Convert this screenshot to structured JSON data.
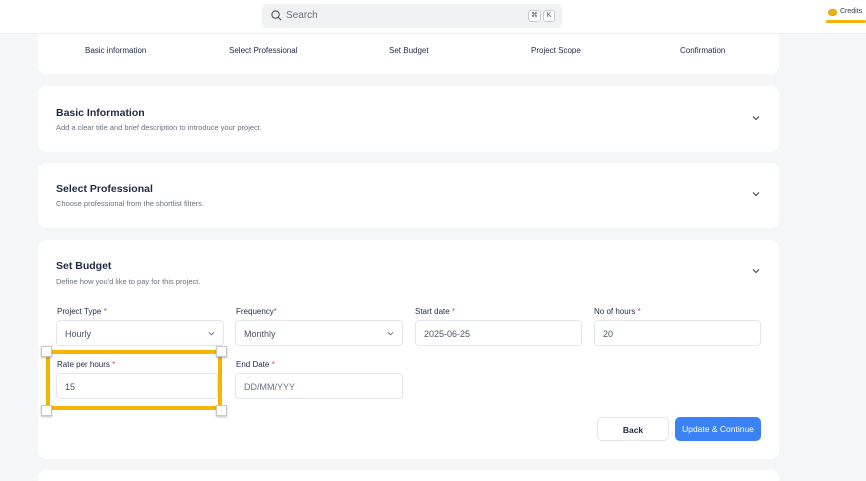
{
  "search": {
    "placeholder": "Search",
    "shortcut_cmd": "⌘",
    "shortcut_key": "K"
  },
  "credits": {
    "label": "Credits",
    "coin_color": "#f2b30b"
  },
  "stepper": {
    "steps": [
      "Basic information",
      "Select Professional",
      "Set Budget",
      "Project Scope",
      "Confirmation"
    ]
  },
  "sections": {
    "basic": {
      "title": "Basic Information",
      "description": "Add a clear title and brief description to introduce your project."
    },
    "professional": {
      "title": "Select Professional",
      "description": "Choose professional from the shortlist filters."
    },
    "budget": {
      "title": "Set Budget",
      "description": "Define how you'd like to pay for this project."
    }
  },
  "form": {
    "project_type": {
      "label": "Project Type",
      "value": "Hourly"
    },
    "frequency": {
      "label": "Frequency",
      "value": "Monthly"
    },
    "start_date": {
      "label": "Start date",
      "value": "2025-06-25"
    },
    "no_of_hours": {
      "label": "No of hours",
      "value": "20"
    },
    "rate_per_hours": {
      "label": "Rate per hours",
      "value": "15"
    },
    "end_date": {
      "label": "End Date",
      "placeholder": "DD/MM/YYY"
    },
    "required_mark": "*"
  },
  "buttons": {
    "back": "Back",
    "update_continue": "Update & Continue"
  },
  "colors": {
    "accent": "#3b82f6",
    "highlight": "#f4b400",
    "required": "#e0465a"
  }
}
